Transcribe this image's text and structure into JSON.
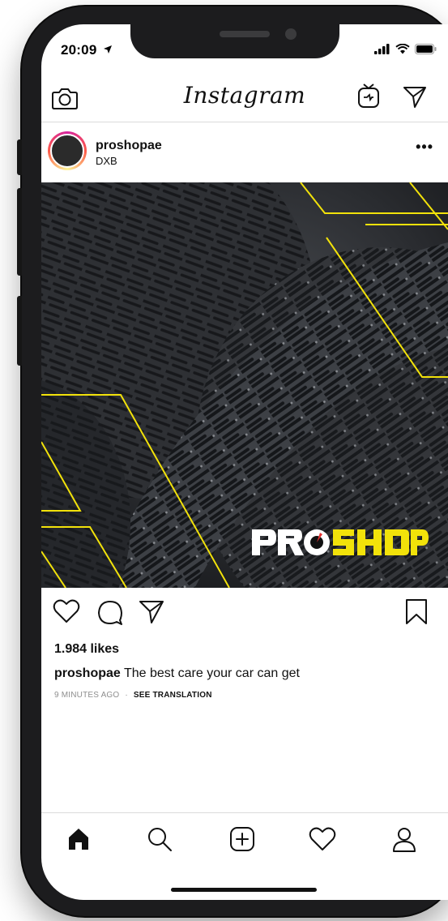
{
  "status_bar": {
    "time": "20:09"
  },
  "header": {
    "logo": "Instagram"
  },
  "post": {
    "username": "proshopae",
    "location": "DXB",
    "more": "•••",
    "image": {
      "brand_wordmark": "PROSHOP",
      "accent_color": "#f2e20a"
    },
    "likes": "1.984 likes",
    "caption": {
      "user": "proshopae",
      "text": " The best care your car can get"
    },
    "time_ago": "9 MINUTES AGO",
    "separator": "·",
    "see_translation": "SEE TRANSLATION"
  },
  "icons": {
    "header": [
      "camera-icon",
      "igtv-icon",
      "direct-message-icon"
    ],
    "actions": [
      "heart-icon",
      "comment-icon",
      "share-icon",
      "bookmark-icon"
    ],
    "nav": [
      "home-icon",
      "search-icon",
      "new-post-icon",
      "activity-heart-icon",
      "profile-icon"
    ]
  },
  "colors": {
    "text": "#111111",
    "muted": "#8e8e8e",
    "divider": "#dbdbdb",
    "brand_yellow": "#f2e20a"
  }
}
